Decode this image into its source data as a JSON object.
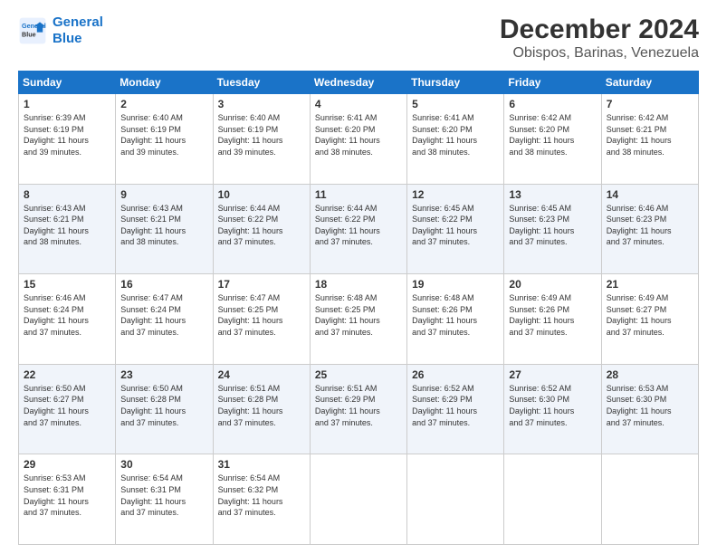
{
  "logo": {
    "line1": "General",
    "line2": "Blue"
  },
  "title": "December 2024",
  "location": "Obispos, Barinas, Venezuela",
  "weekdays": [
    "Sunday",
    "Monday",
    "Tuesday",
    "Wednesday",
    "Thursday",
    "Friday",
    "Saturday"
  ],
  "weeks": [
    [
      {
        "day": "1",
        "sunrise": "6:39 AM",
        "sunset": "6:19 PM",
        "daylight": "11 hours and 39 minutes."
      },
      {
        "day": "2",
        "sunrise": "6:40 AM",
        "sunset": "6:19 PM",
        "daylight": "11 hours and 39 minutes."
      },
      {
        "day": "3",
        "sunrise": "6:40 AM",
        "sunset": "6:19 PM",
        "daylight": "11 hours and 39 minutes."
      },
      {
        "day": "4",
        "sunrise": "6:41 AM",
        "sunset": "6:20 PM",
        "daylight": "11 hours and 38 minutes."
      },
      {
        "day": "5",
        "sunrise": "6:41 AM",
        "sunset": "6:20 PM",
        "daylight": "11 hours and 38 minutes."
      },
      {
        "day": "6",
        "sunrise": "6:42 AM",
        "sunset": "6:20 PM",
        "daylight": "11 hours and 38 minutes."
      },
      {
        "day": "7",
        "sunrise": "6:42 AM",
        "sunset": "6:21 PM",
        "daylight": "11 hours and 38 minutes."
      }
    ],
    [
      {
        "day": "8",
        "sunrise": "6:43 AM",
        "sunset": "6:21 PM",
        "daylight": "11 hours and 38 minutes."
      },
      {
        "day": "9",
        "sunrise": "6:43 AM",
        "sunset": "6:21 PM",
        "daylight": "11 hours and 38 minutes."
      },
      {
        "day": "10",
        "sunrise": "6:44 AM",
        "sunset": "6:22 PM",
        "daylight": "11 hours and 37 minutes."
      },
      {
        "day": "11",
        "sunrise": "6:44 AM",
        "sunset": "6:22 PM",
        "daylight": "11 hours and 37 minutes."
      },
      {
        "day": "12",
        "sunrise": "6:45 AM",
        "sunset": "6:22 PM",
        "daylight": "11 hours and 37 minutes."
      },
      {
        "day": "13",
        "sunrise": "6:45 AM",
        "sunset": "6:23 PM",
        "daylight": "11 hours and 37 minutes."
      },
      {
        "day": "14",
        "sunrise": "6:46 AM",
        "sunset": "6:23 PM",
        "daylight": "11 hours and 37 minutes."
      }
    ],
    [
      {
        "day": "15",
        "sunrise": "6:46 AM",
        "sunset": "6:24 PM",
        "daylight": "11 hours and 37 minutes."
      },
      {
        "day": "16",
        "sunrise": "6:47 AM",
        "sunset": "6:24 PM",
        "daylight": "11 hours and 37 minutes."
      },
      {
        "day": "17",
        "sunrise": "6:47 AM",
        "sunset": "6:25 PM",
        "daylight": "11 hours and 37 minutes."
      },
      {
        "day": "18",
        "sunrise": "6:48 AM",
        "sunset": "6:25 PM",
        "daylight": "11 hours and 37 minutes."
      },
      {
        "day": "19",
        "sunrise": "6:48 AM",
        "sunset": "6:26 PM",
        "daylight": "11 hours and 37 minutes."
      },
      {
        "day": "20",
        "sunrise": "6:49 AM",
        "sunset": "6:26 PM",
        "daylight": "11 hours and 37 minutes."
      },
      {
        "day": "21",
        "sunrise": "6:49 AM",
        "sunset": "6:27 PM",
        "daylight": "11 hours and 37 minutes."
      }
    ],
    [
      {
        "day": "22",
        "sunrise": "6:50 AM",
        "sunset": "6:27 PM",
        "daylight": "11 hours and 37 minutes."
      },
      {
        "day": "23",
        "sunrise": "6:50 AM",
        "sunset": "6:28 PM",
        "daylight": "11 hours and 37 minutes."
      },
      {
        "day": "24",
        "sunrise": "6:51 AM",
        "sunset": "6:28 PM",
        "daylight": "11 hours and 37 minutes."
      },
      {
        "day": "25",
        "sunrise": "6:51 AM",
        "sunset": "6:29 PM",
        "daylight": "11 hours and 37 minutes."
      },
      {
        "day": "26",
        "sunrise": "6:52 AM",
        "sunset": "6:29 PM",
        "daylight": "11 hours and 37 minutes."
      },
      {
        "day": "27",
        "sunrise": "6:52 AM",
        "sunset": "6:30 PM",
        "daylight": "11 hours and 37 minutes."
      },
      {
        "day": "28",
        "sunrise": "6:53 AM",
        "sunset": "6:30 PM",
        "daylight": "11 hours and 37 minutes."
      }
    ],
    [
      {
        "day": "29",
        "sunrise": "6:53 AM",
        "sunset": "6:31 PM",
        "daylight": "11 hours and 37 minutes."
      },
      {
        "day": "30",
        "sunrise": "6:54 AM",
        "sunset": "6:31 PM",
        "daylight": "11 hours and 37 minutes."
      },
      {
        "day": "31",
        "sunrise": "6:54 AM",
        "sunset": "6:32 PM",
        "daylight": "11 hours and 37 minutes."
      },
      null,
      null,
      null,
      null
    ]
  ]
}
